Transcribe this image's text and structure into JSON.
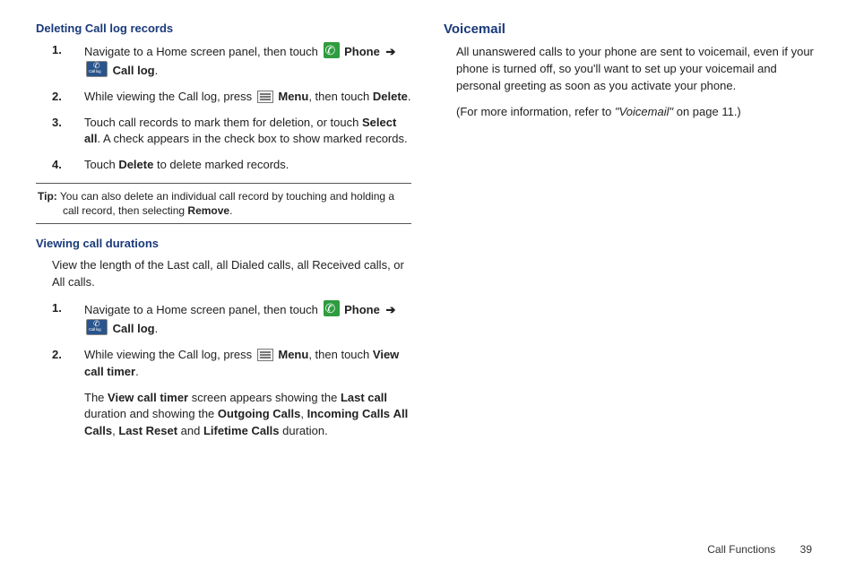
{
  "left": {
    "heading1": "Deleting Call log records",
    "steps1": {
      "s1a": "Navigate to a Home screen panel, then touch ",
      "s1_phone": "Phone",
      "s1_calllog": "Call log",
      "s1b": ".",
      "s2a": "While viewing the Call log, press ",
      "s2_menu": "Menu",
      "s2b": ", then touch ",
      "s2_delete": "Delete",
      "s2c": ".",
      "s3a": "Touch call records to mark them for deletion, or touch ",
      "s3_selectall": "Select all",
      "s3b": ". A check appears in the check box to show marked records.",
      "s4a": "Touch ",
      "s4_delete": "Delete",
      "s4b": " to delete marked records."
    },
    "tip_label": "Tip:",
    "tip_a": " You can also delete an individual call record by touching and holding a call record, then selecting ",
    "tip_remove": "Remove",
    "tip_b": ".",
    "heading2": "Viewing call durations",
    "intro2": "View the length of the Last call, all Dialed calls, all Received calls, or All calls.",
    "steps2": {
      "s1a": "Navigate to a Home screen panel, then touch ",
      "s1_phone": "Phone",
      "s1_calllog": "Call log",
      "s1b": ".",
      "s2a": "While viewing the Call log, press ",
      "s2_menu": "Menu",
      "s2b": ", then touch ",
      "s2_vct": "View call timer",
      "s2c": "."
    },
    "para2a": "The ",
    "para2_vct": "View call timer",
    "para2b": " screen appears showing the ",
    "para2_lastcall": "Last call",
    "para2c": " duration and showing the ",
    "para2_outgoing": "Outgoing Calls",
    "para2d": ", ",
    "para2_incoming": "Incoming Calls",
    "para2e": " ",
    "para2_allcalls": "All Calls",
    "para2f": ", ",
    "para2_lastreset": "Last Reset",
    "para2g": " and ",
    "para2_lifetime": "Lifetime Calls",
    "para2h": " duration."
  },
  "right": {
    "heading": "Voicemail",
    "p1": "All unanswered calls to your phone are sent to voicemail, even if your phone is turned off, so you'll want to set up your voicemail and personal greeting as soon as you activate your phone.",
    "p2a": "(For more information, refer to ",
    "p2_ref": "\"Voicemail\"",
    "p2b": " on page 11.)"
  },
  "footer": {
    "section": "Call Functions",
    "page": "39"
  },
  "arrow": "➔"
}
